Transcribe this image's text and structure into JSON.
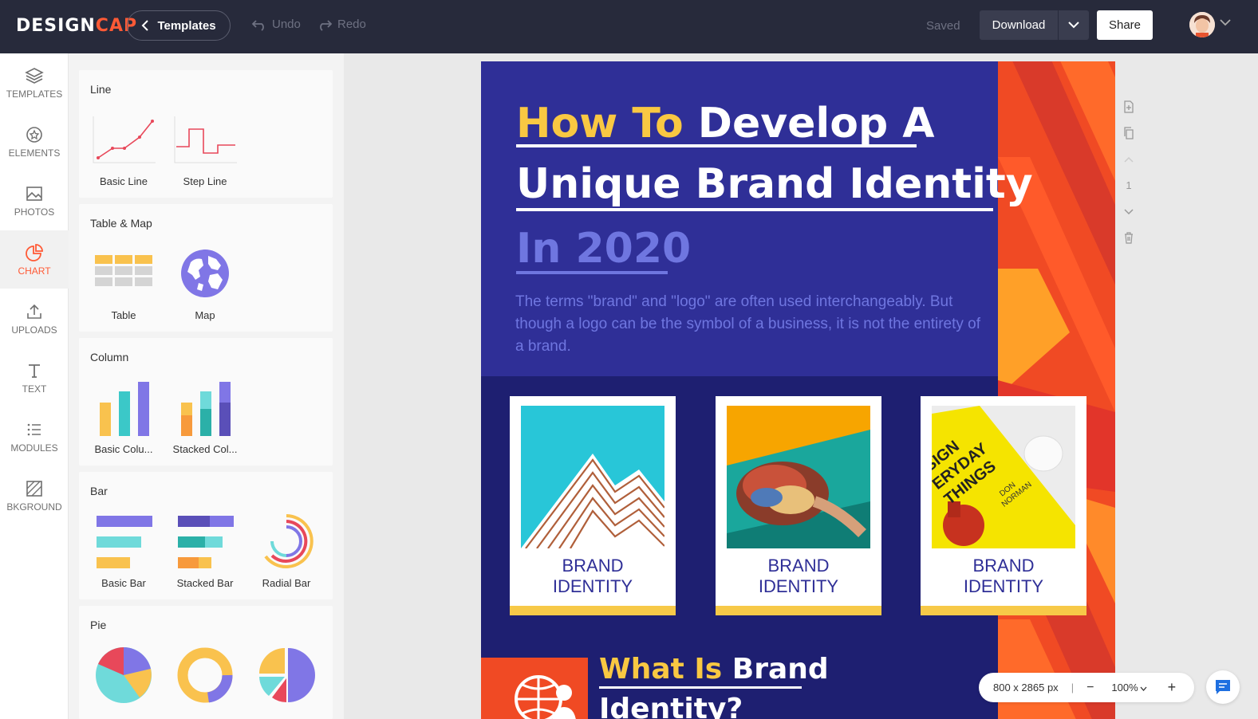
{
  "topbar": {
    "logo_left": "DESIGN",
    "logo_right": "CAP",
    "templates_label": "Templates",
    "undo_label": "Undo",
    "redo_label": "Redo",
    "saved_label": "Saved",
    "download_label": "Download",
    "share_label": "Share"
  },
  "sidebar": {
    "items": [
      {
        "label": "TEMPLATES",
        "icon": "layers-icon"
      },
      {
        "label": "ELEMENTS",
        "icon": "elements-icon"
      },
      {
        "label": "PHOTOS",
        "icon": "image-icon"
      },
      {
        "label": "CHART",
        "icon": "pie-chart-icon",
        "active": true
      },
      {
        "label": "UPLOADS",
        "icon": "upload-icon"
      },
      {
        "label": "TEXT",
        "icon": "text-icon"
      },
      {
        "label": "MODULES",
        "icon": "list-icon"
      },
      {
        "label": "BKGROUND",
        "icon": "background-icon"
      }
    ]
  },
  "panel": {
    "sections": [
      {
        "title": "Line",
        "items": [
          "Basic Line",
          "Step Line"
        ]
      },
      {
        "title": "Table & Map",
        "items": [
          "Table",
          "Map"
        ]
      },
      {
        "title": "Column",
        "items": [
          "Basic Colu...",
          "Stacked Col..."
        ]
      },
      {
        "title": "Bar",
        "items": [
          "Basic Bar",
          "Stacked Bar",
          "Radial Bar"
        ]
      },
      {
        "title": "Pie",
        "items": []
      }
    ]
  },
  "canvas": {
    "title_line1_yellow": "How To",
    "title_line1_white": "Develop A",
    "title_line2": "Unique Brand Identity",
    "title_line3": "In 2020",
    "description": "The terms \"brand\" and \"logo\" are often used interchangeably. But though a logo can be the symbol of a business, it is not the entirety of a brand.",
    "cards": [
      {
        "line1": "BRAND",
        "line2": "IDENTITY"
      },
      {
        "line1": "BRAND",
        "line2": "IDENTITY"
      },
      {
        "line1": "BRAND",
        "line2": "IDENTITY"
      }
    ],
    "book_text_1": "SIGN",
    "book_text_2": "ERYDAY",
    "book_text_3": "THINGS",
    "book_author_1": "DON",
    "book_author_2": "NORMAN",
    "section2_yellow": "What Is",
    "section2_white": "Brand",
    "section2_line2": "Identity?"
  },
  "page_tools": {
    "page_number": "1"
  },
  "zoom": {
    "dimensions": "800 x 2865 px",
    "separator": "|",
    "minus": "−",
    "level": "100%",
    "plus": "+"
  },
  "colors": {
    "topbar": "#272a3b",
    "accent": "#ff5a36",
    "hero": "#2f2f97",
    "navy": "#1e1f71",
    "yellow": "#f9c842",
    "red_stripe": "#f04a24"
  }
}
